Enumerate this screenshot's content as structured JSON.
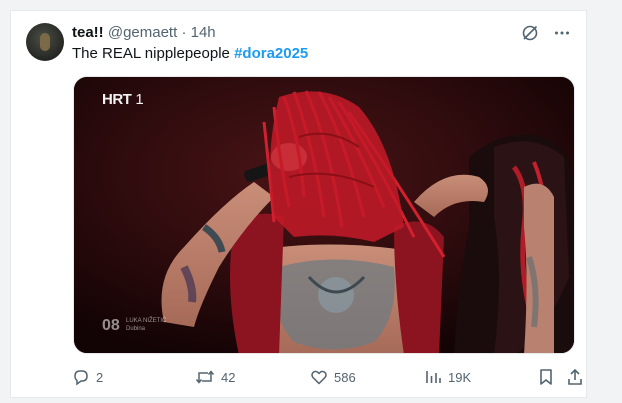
{
  "tweet": {
    "display_name": "tea!!",
    "handle": "@gemaett",
    "separator": "·",
    "time": "14h",
    "text": "The REAL nipplepeople",
    "hashtag": "#dora2025"
  },
  "media": {
    "channel_logo": "HRT",
    "channel_number": "1",
    "performer_number": "08",
    "performer_name": "LUKA NIŽETIĆ",
    "song_title": "Dubina"
  },
  "actions": {
    "replies": "2",
    "reposts": "42",
    "likes": "586",
    "views": "19K"
  },
  "colors": {
    "hashtag": "#1d9bf0",
    "muted": "#536471",
    "text": "#0f1419"
  },
  "icons": [
    "grok-icon",
    "more-icon",
    "reply-icon",
    "repost-icon",
    "like-icon",
    "views-icon",
    "bookmark-icon",
    "share-icon"
  ]
}
